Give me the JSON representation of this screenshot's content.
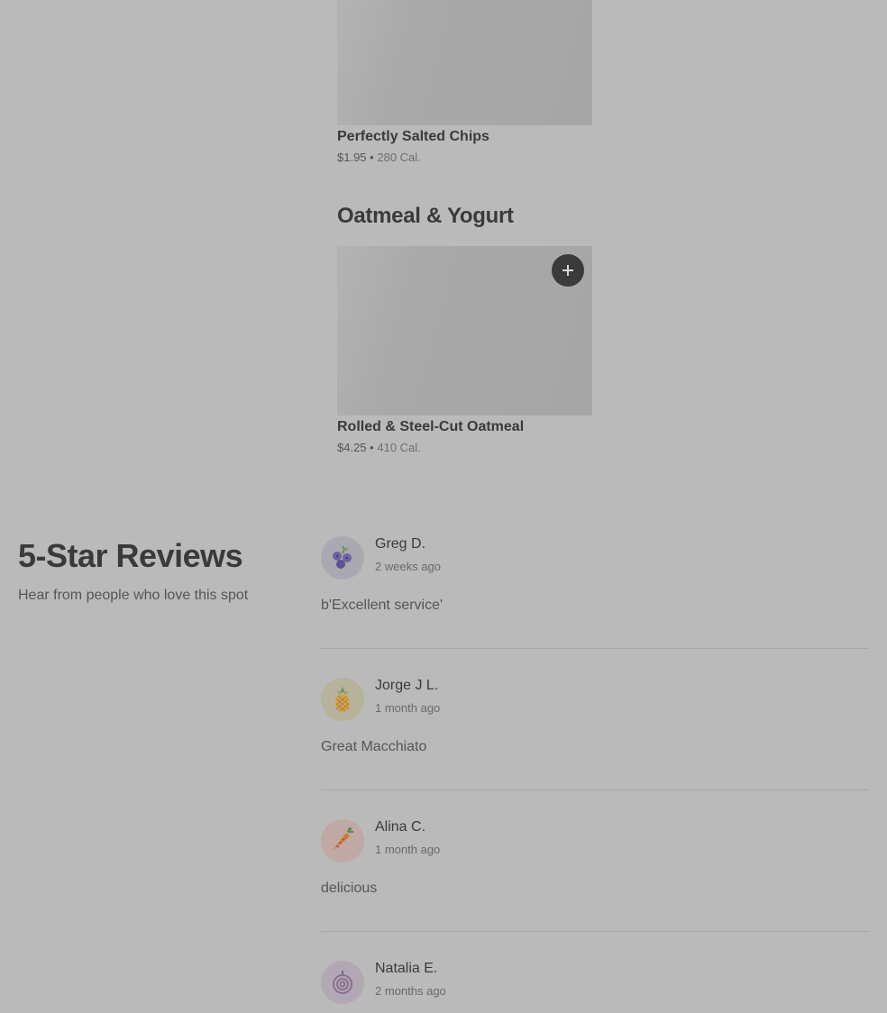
{
  "menu": {
    "items_top": [
      {
        "name": "Perfectly Salted Chips",
        "price": "$1.95",
        "separator": "•",
        "calories": "280 Cal."
      }
    ],
    "section": {
      "title": "Oatmeal & Yogurt",
      "add_icon": "plus-icon",
      "items": [
        {
          "name": "Rolled & Steel-Cut Oatmeal",
          "price": "$4.25",
          "separator": "•",
          "calories": "410 Cal."
        }
      ]
    }
  },
  "reviews": {
    "title": "5-Star Reviews",
    "subtitle": "Hear from people who love this spot",
    "list": [
      {
        "name": "Greg D.",
        "time": "2 weeks ago",
        "text": "b'Excellent service'",
        "avatar_icon": "blueberry-icon",
        "avatar_bg": "#a9a9b1"
      },
      {
        "name": "Jorge J L.",
        "time": "1 month ago",
        "text": "Great Macchiato",
        "avatar_icon": "pineapple-icon",
        "avatar_bg": "#b6b29c"
      },
      {
        "name": "Alina C.",
        "time": "1 month ago",
        "text": "delicious",
        "avatar_icon": "carrot-icon",
        "avatar_bg": "#c0a9a4"
      },
      {
        "name": "Natalia E.",
        "time": "2 months ago",
        "text": "",
        "avatar_icon": "onion-icon",
        "avatar_bg": "#b2a8b3"
      }
    ]
  },
  "colors": {
    "background": "#bababa",
    "add_button": "#3b3b3b",
    "text_primary": "#3a3a3a"
  }
}
